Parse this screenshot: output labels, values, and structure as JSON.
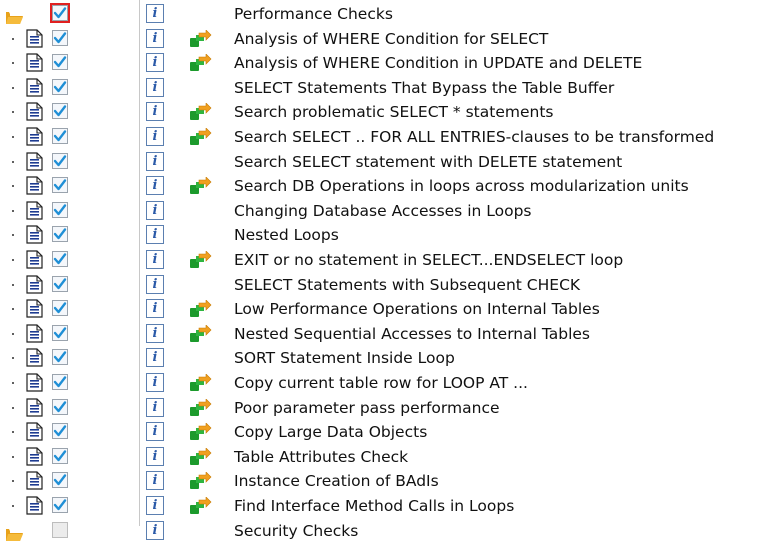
{
  "colors": {
    "folder": "#e8a21a",
    "check": "#1f8fd6",
    "focus_outline": "#e02020",
    "exec_green": "#1c9a2c",
    "exec_orange": "#f0a020",
    "doc_line": "#1d3b91"
  },
  "icons": {
    "folder": "folder-icon",
    "document": "document-icon",
    "checkbox": "checkbox-checked-icon",
    "info": "info-icon",
    "execute": "execute-arrow-icon"
  },
  "tree": {
    "parent": {
      "label": "Performance Checks",
      "checked": true,
      "info_glyph": "i"
    },
    "items": [
      {
        "label": "Analysis of WHERE Condition for SELECT",
        "checked": true,
        "has_exec": true,
        "info_glyph": "i"
      },
      {
        "label": "Analysis of WHERE Condition in UPDATE and DELETE",
        "checked": true,
        "has_exec": true,
        "info_glyph": "i"
      },
      {
        "label": "SELECT Statements That Bypass the Table Buffer",
        "checked": true,
        "has_exec": false,
        "info_glyph": "i"
      },
      {
        "label": "Search problematic SELECT * statements",
        "checked": true,
        "has_exec": true,
        "info_glyph": "i"
      },
      {
        "label": "Search SELECT .. FOR ALL ENTRIES-clauses to be transformed",
        "checked": true,
        "has_exec": true,
        "info_glyph": "i"
      },
      {
        "label": "Search SELECT statement with DELETE statement",
        "checked": true,
        "has_exec": false,
        "info_glyph": "i"
      },
      {
        "label": "Search DB Operations in loops across modularization units",
        "checked": true,
        "has_exec": true,
        "info_glyph": "i"
      },
      {
        "label": "Changing Database Accesses in Loops",
        "checked": true,
        "has_exec": false,
        "info_glyph": "i"
      },
      {
        "label": "Nested Loops",
        "checked": true,
        "has_exec": false,
        "info_glyph": "i"
      },
      {
        "label": "EXIT or no statement in SELECT...ENDSELECT loop",
        "checked": true,
        "has_exec": true,
        "info_glyph": "i"
      },
      {
        "label": "SELECT Statements with Subsequent CHECK",
        "checked": true,
        "has_exec": false,
        "info_glyph": "i"
      },
      {
        "label": "Low Performance Operations on Internal Tables",
        "checked": true,
        "has_exec": true,
        "info_glyph": "i"
      },
      {
        "label": "Nested Sequential Accesses to Internal Tables",
        "checked": true,
        "has_exec": true,
        "info_glyph": "i"
      },
      {
        "label": "SORT Statement Inside Loop",
        "checked": true,
        "has_exec": false,
        "info_glyph": "i"
      },
      {
        "label": "Copy current table row for LOOP AT ...",
        "checked": true,
        "has_exec": true,
        "info_glyph": "i"
      },
      {
        "label": "Poor parameter pass performance",
        "checked": true,
        "has_exec": true,
        "info_glyph": "i"
      },
      {
        "label": "Copy Large Data Objects",
        "checked": true,
        "has_exec": true,
        "info_glyph": "i"
      },
      {
        "label": "Table Attributes Check",
        "checked": true,
        "has_exec": true,
        "info_glyph": "i"
      },
      {
        "label": "Instance Creation of BAdIs",
        "checked": true,
        "has_exec": true,
        "info_glyph": "i"
      },
      {
        "label": "Find Interface Method Calls in Loops",
        "checked": true,
        "has_exec": true,
        "info_glyph": "i"
      }
    ],
    "next_parent": {
      "label": "Security Checks",
      "checked": false,
      "info_glyph": "i"
    }
  }
}
